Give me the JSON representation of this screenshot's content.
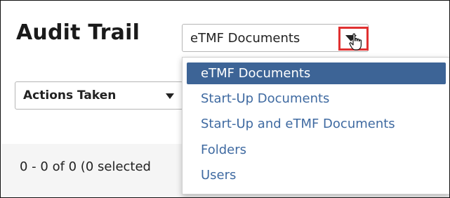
{
  "page": {
    "title": "Audit Trail"
  },
  "document_type_select": {
    "value": "eTMF Documents",
    "options": [
      "eTMF Documents",
      "Start-Up Documents",
      "Start-Up and eTMF Documents",
      "Folders",
      "Users"
    ],
    "selected_index": 0,
    "arrow_icon": "dropdown-arrow-icon",
    "highlight_color": "#e03131"
  },
  "actions_select": {
    "value": "Actions Taken",
    "arrow_icon": "dropdown-arrow-icon"
  },
  "results": {
    "count_text": "0 - 0 of 0 (0 selected"
  },
  "colors": {
    "option_text": "#3f6aa1",
    "option_selected_bg": "#3d6496",
    "option_selected_text": "#ffffff"
  },
  "cursor_icon": "hand-pointer-icon"
}
